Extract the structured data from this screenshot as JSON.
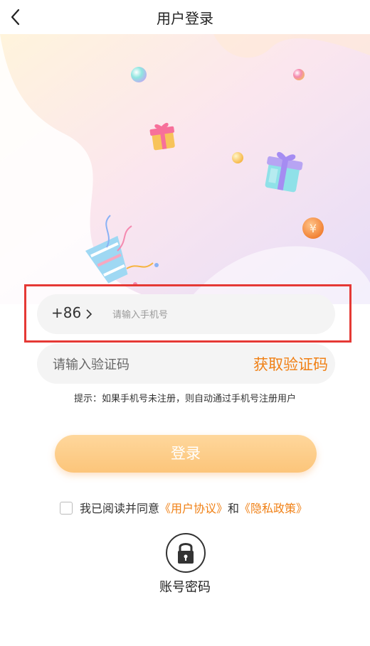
{
  "header": {
    "title": "用户登录"
  },
  "phone": {
    "country_code": "+86",
    "placeholder": "请输入手机号"
  },
  "code": {
    "placeholder": "请输入验证码",
    "get_code_label": "获取验证码"
  },
  "hint": "提示：如果手机号未注册，则自动通过手机号注册用户",
  "login_button": "登录",
  "agreement": {
    "prefix": "我已阅读并同意",
    "user_agreement": "《用户协议》",
    "and": "和",
    "privacy_policy": "《隐私政策》",
    "checked": false
  },
  "password_login": {
    "label": "账号密码",
    "icon": "lock-icon"
  },
  "colors": {
    "accent": "#f08015",
    "login_button": "#fcc57a",
    "highlight": "#e53935"
  }
}
